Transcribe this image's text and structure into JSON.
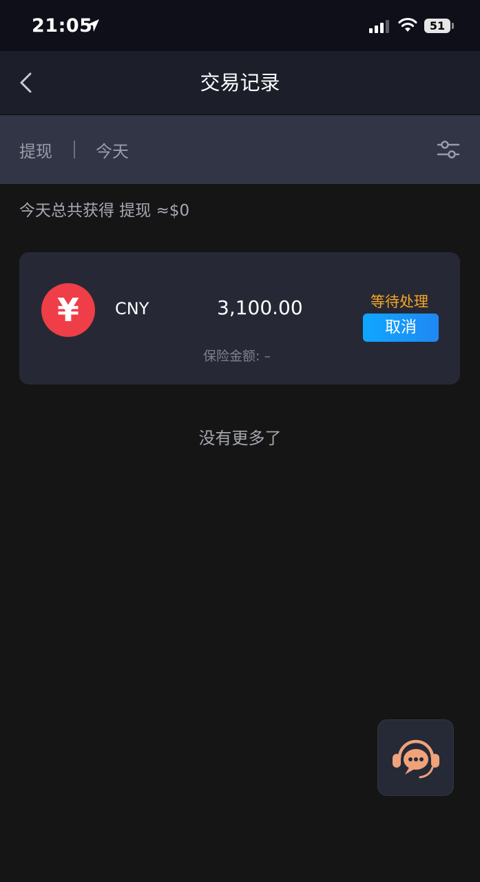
{
  "status_bar": {
    "time": "21:05",
    "battery": "51"
  },
  "nav": {
    "title": "交易记录"
  },
  "filter": {
    "type": "提现",
    "date": "今天"
  },
  "summary": "今天总共获得 提现 ≈$0",
  "records": [
    {
      "currency_symbol": "¥",
      "currency": "CNY",
      "amount": "3,100.00",
      "status": "等待处理",
      "action_label": "取消",
      "insurance_label": "保险金额: –"
    }
  ],
  "footer": {
    "no_more": "没有更多了"
  },
  "colors": {
    "background": "#151515",
    "nav": "#1c1f2a",
    "filter_bar": "#323545",
    "card": "#262935",
    "coin": "#ef3e47",
    "status": "#f5a623",
    "cancel": "#0fa7ff",
    "support_icon": "#f0a27a"
  },
  "icons": {
    "back": "chevron-left-icon",
    "filter": "sliders-icon",
    "support": "headset-chat-icon",
    "location": "location-arrow-icon",
    "signal": "signal-icon",
    "wifi": "wifi-icon"
  }
}
